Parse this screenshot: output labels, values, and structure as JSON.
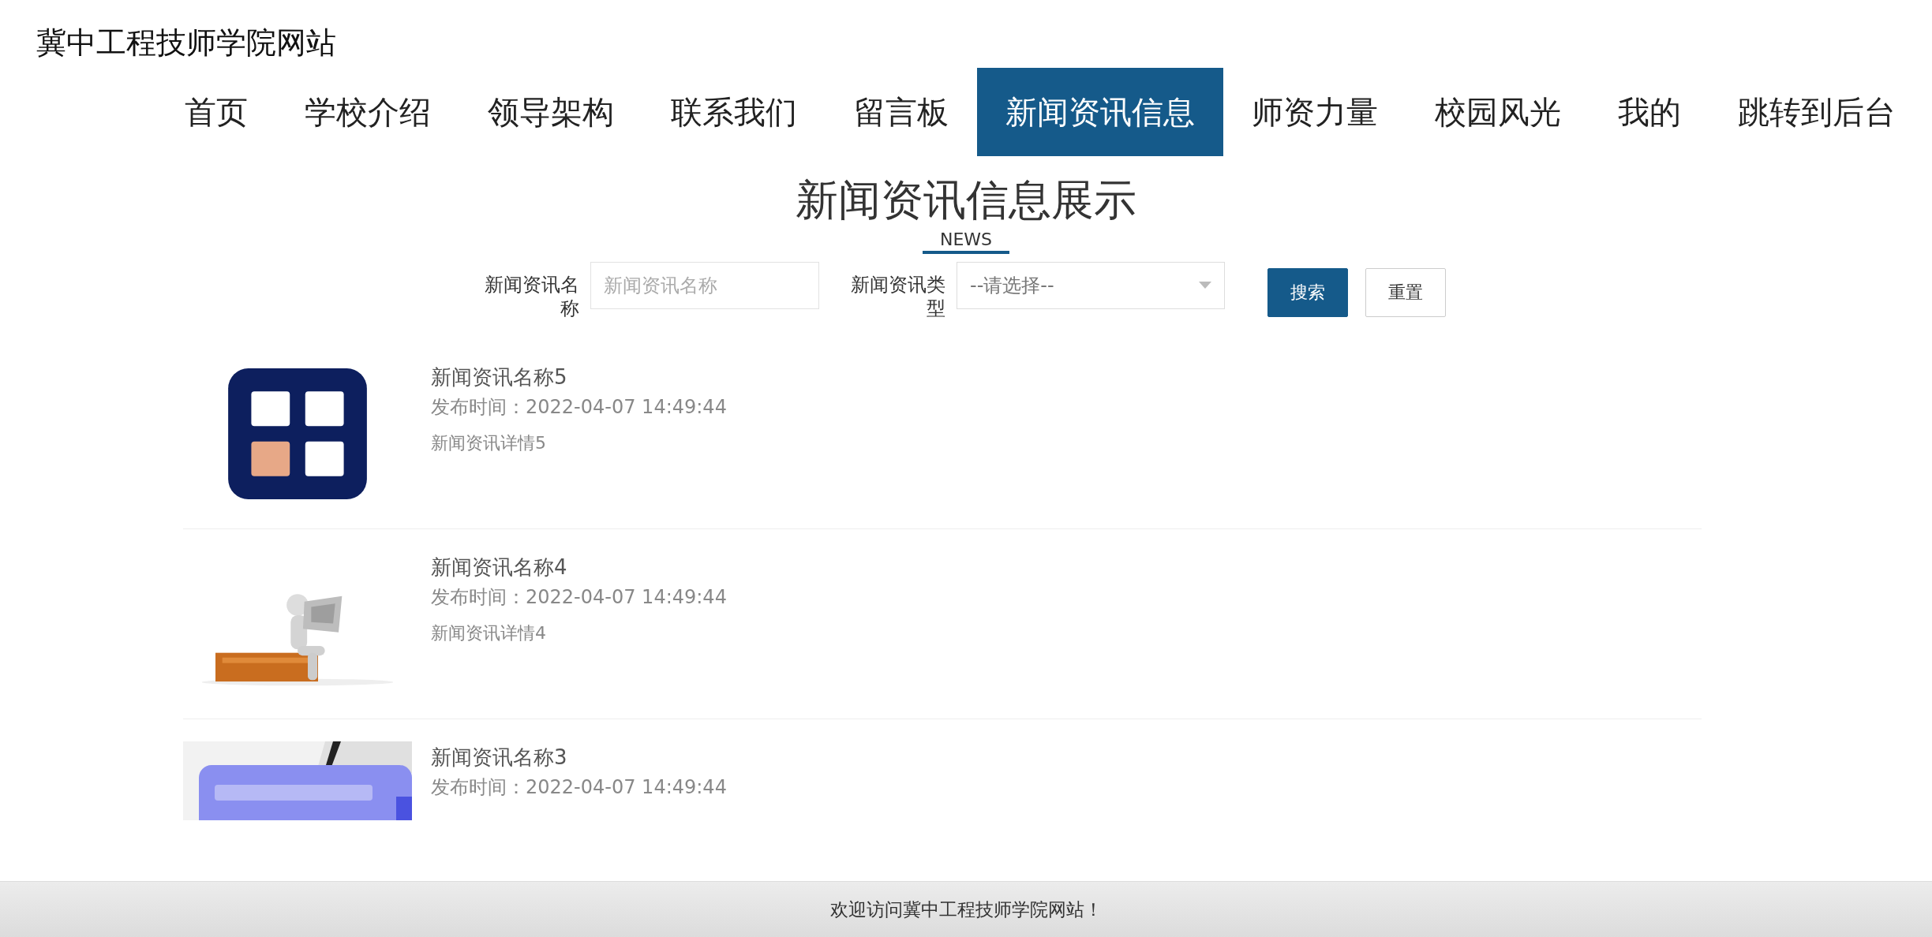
{
  "site_title": "冀中工程技师学院网站",
  "nav": [
    {
      "label": "首页",
      "selected": false
    },
    {
      "label": "学校介绍",
      "selected": false
    },
    {
      "label": "领导架构",
      "selected": false
    },
    {
      "label": "联系我们",
      "selected": false
    },
    {
      "label": "留言板",
      "selected": false
    },
    {
      "label": "新闻资讯信息",
      "selected": true
    },
    {
      "label": "师资力量",
      "selected": false
    },
    {
      "label": "校园风光",
      "selected": false
    },
    {
      "label": "我的",
      "selected": false
    },
    {
      "label": "跳转到后台",
      "selected": false
    }
  ],
  "heading": "新闻资讯信息展示",
  "subheading": "NEWS",
  "search": {
    "name_label": "新闻资讯名称",
    "name_placeholder": "新闻资讯名称",
    "type_label": "新闻资讯类型",
    "type_value": "--请选择--",
    "search_button": "搜索",
    "reset_button": "重置"
  },
  "news": [
    {
      "kind": "badge",
      "name": "新闻资讯名称5",
      "time": "发布时间：2022-04-07 14:49:44",
      "detail": "新闻资讯详情5"
    },
    {
      "kind": "figure",
      "name": "新闻资讯名称4",
      "time": "发布时间：2022-04-07 14:49:44",
      "detail": "新闻资讯详情4"
    },
    {
      "kind": "key",
      "name": "新闻资讯名称3",
      "time": "发布时间：2022-04-07 14:49:44"
    }
  ],
  "footer": "欢迎访问冀中工程技师学院网站！"
}
